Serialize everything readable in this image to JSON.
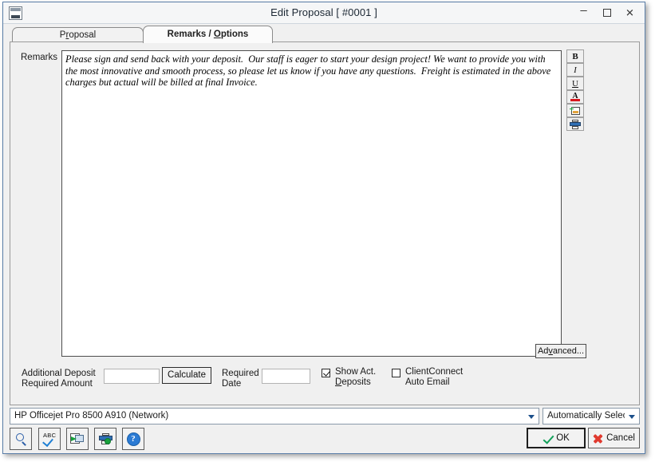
{
  "window": {
    "title": "Edit Proposal [ #0001 ]",
    "icon": "window-document-icon",
    "controls": {
      "minimize": "–",
      "maximize": "",
      "close": "✕"
    }
  },
  "tabs": [
    {
      "label_pre": "P",
      "label_key": "r",
      "label_post": "oposal",
      "selected": false
    },
    {
      "label_pre": "Remarks / ",
      "label_key": "O",
      "label_post": "ptions",
      "selected": true
    }
  ],
  "form": {
    "remarks_label": "Remarks",
    "remarks_value": "Please sign and send back with your deposit.  Our staff is eager to start your design project! We want to provide you with the most innovative and smooth process, so please let us know if you have any questions.  Freight is estimated in the above charges but actual will be billed at final Invoice.",
    "format_toolbar": [
      {
        "name": "bold-button",
        "label": "B"
      },
      {
        "name": "italic-button",
        "label": "I"
      },
      {
        "name": "underline-button",
        "label": "U"
      },
      {
        "name": "font-color-button",
        "label": "A",
        "color": "#d8161c"
      },
      {
        "name": "insert-image-button",
        "label": ""
      },
      {
        "name": "print-remarks-button",
        "label": ""
      }
    ],
    "advanced_button": {
      "pre": "Ad",
      "key": "v",
      "post": "anced..."
    },
    "additional_deposit_label_line1": "Additional Deposit",
    "additional_deposit_label_line2": "Required Amount",
    "additional_deposit_value": "",
    "calculate_button": "Calculate",
    "required_date_label_line1": "Required",
    "required_date_label_line2": "Date",
    "required_date_value": "",
    "show_act_deposits": {
      "line1": "Show Act.",
      "key": "D",
      "line2_post": "eposits",
      "checked": true
    },
    "client_connect": {
      "line1": "ClientConnect",
      "line2": "Auto Email",
      "checked": false
    }
  },
  "printing": {
    "printer_value": "HP Officejet Pro 8500 A910 (Network)",
    "tray_value": "Automatically Select"
  },
  "toolbar": [
    {
      "name": "print-preview-button",
      "icon": "magnifier-icon"
    },
    {
      "name": "spell-check-button",
      "icon": "abc-check-icon"
    },
    {
      "name": "export-document-button",
      "icon": "export-document-icon"
    },
    {
      "name": "printer-setup-button",
      "icon": "printer-setup-icon"
    },
    {
      "name": "help-button",
      "icon": "help-icon"
    }
  ],
  "actions": {
    "ok_label": "OK",
    "cancel_label": "Cancel"
  },
  "colors": {
    "window_border": "#5a7ea8",
    "accent_green": "#12a05a",
    "accent_red": "#e03a2f",
    "dialog_bg": "#f0f0f0"
  }
}
